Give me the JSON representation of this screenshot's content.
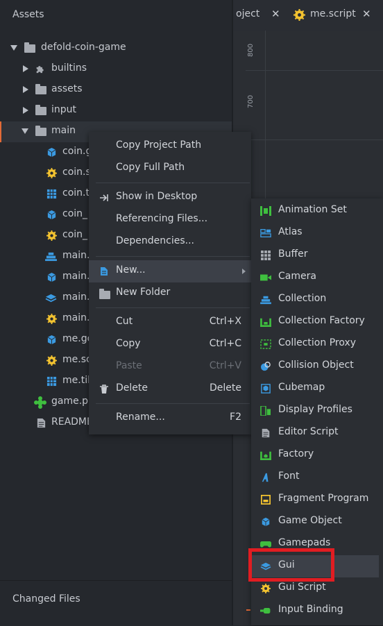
{
  "assets_panel": {
    "title": "Assets",
    "tree": [
      {
        "label": "defold-coin-game",
        "icon": "folder-icon",
        "expanded": true
      },
      {
        "label": "builtins",
        "icon": "puzzle-icon",
        "expanded": false
      },
      {
        "label": "assets",
        "icon": "folder-icon",
        "expanded": false
      },
      {
        "label": "input",
        "icon": "folder-icon",
        "expanded": false
      },
      {
        "label": "main",
        "icon": "folder-icon",
        "expanded": true,
        "selected": true
      },
      {
        "label": "coin.g",
        "icon": "game-object-icon"
      },
      {
        "label": "coin.s",
        "icon": "script-gear-icon"
      },
      {
        "label": "coin.t",
        "icon": "tilemap-grid-icon"
      },
      {
        "label": "coin_",
        "icon": "game-object-icon"
      },
      {
        "label": "coin_",
        "icon": "script-gear-icon"
      },
      {
        "label": "main.",
        "icon": "collection-icon"
      },
      {
        "label": "main.",
        "icon": "game-object-icon"
      },
      {
        "label": "main.",
        "icon": "gui-icon"
      },
      {
        "label": "main.",
        "icon": "script-gear-icon"
      },
      {
        "label": "me.go",
        "icon": "game-object-icon"
      },
      {
        "label": "me.sc",
        "icon": "script-gear-icon"
      },
      {
        "label": "me.til",
        "icon": "tilemap-grid-icon"
      },
      {
        "label": "game.pr",
        "icon": "project-icon"
      },
      {
        "label": "README",
        "icon": "document-icon"
      }
    ]
  },
  "changed_files": {
    "title": "Changed Files"
  },
  "tabs": [
    {
      "label": "oject",
      "closable": true
    },
    {
      "label": "me.script",
      "closable": true
    }
  ],
  "editor": {
    "ruler_labels": [
      "800",
      "700"
    ]
  },
  "context_menu": {
    "items": [
      {
        "label": "Copy Project Path",
        "shortcut": ""
      },
      {
        "label": "Copy Full Path",
        "shortcut": ""
      },
      {
        "label": "Show in Desktop",
        "shortcut": "",
        "icon": "show-in-desktop-icon"
      },
      {
        "label": "Referencing Files...",
        "shortcut": ""
      },
      {
        "label": "Dependencies...",
        "shortcut": ""
      },
      {
        "label": "New...",
        "shortcut": "",
        "icon": "new-file-icon",
        "has_submenu": true,
        "highlighted": true
      },
      {
        "label": "New Folder",
        "shortcut": "",
        "icon": "folder-icon"
      },
      {
        "label": "Cut",
        "shortcut": "Ctrl+X"
      },
      {
        "label": "Copy",
        "shortcut": "Ctrl+C"
      },
      {
        "label": "Paste",
        "shortcut": "Ctrl+V",
        "disabled": true
      },
      {
        "label": "Delete",
        "shortcut": "Delete",
        "icon": "trash-icon"
      },
      {
        "label": "Rename...",
        "shortcut": "F2"
      }
    ]
  },
  "new_submenu": {
    "items": [
      {
        "label": "Animation Set",
        "icon": "animation-set-icon"
      },
      {
        "label": "Atlas",
        "icon": "atlas-icon"
      },
      {
        "label": "Buffer",
        "icon": "buffer-icon"
      },
      {
        "label": "Camera",
        "icon": "camera-icon"
      },
      {
        "label": "Collection",
        "icon": "collection-icon"
      },
      {
        "label": "Collection Factory",
        "icon": "collection-factory-icon"
      },
      {
        "label": "Collection Proxy",
        "icon": "collection-proxy-icon"
      },
      {
        "label": "Collision Object",
        "icon": "collision-object-icon"
      },
      {
        "label": "Cubemap",
        "icon": "cubemap-icon"
      },
      {
        "label": "Display Profiles",
        "icon": "display-profiles-icon"
      },
      {
        "label": "Editor Script",
        "icon": "editor-script-icon"
      },
      {
        "label": "Factory",
        "icon": "factory-icon"
      },
      {
        "label": "Font",
        "icon": "font-icon"
      },
      {
        "label": "Fragment Program",
        "icon": "fragment-program-icon"
      },
      {
        "label": "Game Object",
        "icon": "game-object-icon"
      },
      {
        "label": "Gamepads",
        "icon": "gamepads-icon"
      },
      {
        "label": "Gui",
        "icon": "gui-icon",
        "hovered": true
      },
      {
        "label": "Gui Script",
        "icon": "gui-script-icon"
      },
      {
        "label": "Input Binding",
        "icon": "input-binding-icon"
      }
    ]
  },
  "colors": {
    "selection_accent": "#e36a36",
    "highlight_box": "#e11d22",
    "gear_yellow": "#f2c230",
    "cube_blue": "#3b9ae1",
    "icon_green": "#3fbf3f"
  }
}
